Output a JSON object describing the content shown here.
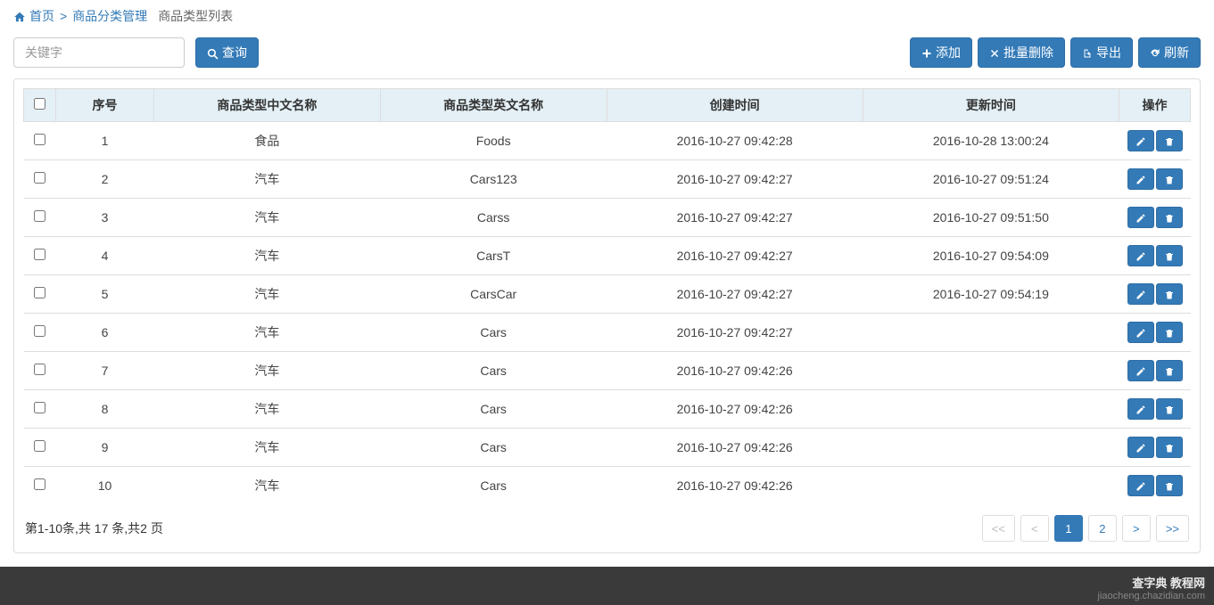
{
  "breadcrumb": {
    "home": "首页",
    "section": "商品分类管理",
    "current": "商品类型列表"
  },
  "search": {
    "placeholder": "关键字",
    "btn": "查询"
  },
  "actions": {
    "add": "添加",
    "batch_delete": "批量删除",
    "export": "导出",
    "refresh": "刷新"
  },
  "table": {
    "headers": {
      "index": "序号",
      "cn_name": "商品类型中文名称",
      "en_name": "商品类型英文名称",
      "created": "创建时间",
      "updated": "更新时间",
      "ops": "操作"
    },
    "rows": [
      {
        "idx": "1",
        "cn": "食品",
        "en": "Foods",
        "created": "2016-10-27 09:42:28",
        "updated": "2016-10-28 13:00:24"
      },
      {
        "idx": "2",
        "cn": "汽车",
        "en": "Cars123",
        "created": "2016-10-27 09:42:27",
        "updated": "2016-10-27 09:51:24"
      },
      {
        "idx": "3",
        "cn": "汽车",
        "en": "Carss",
        "created": "2016-10-27 09:42:27",
        "updated": "2016-10-27 09:51:50"
      },
      {
        "idx": "4",
        "cn": "汽车",
        "en": "CarsT",
        "created": "2016-10-27 09:42:27",
        "updated": "2016-10-27 09:54:09"
      },
      {
        "idx": "5",
        "cn": "汽车",
        "en": "CarsCar",
        "created": "2016-10-27 09:42:27",
        "updated": "2016-10-27 09:54:19"
      },
      {
        "idx": "6",
        "cn": "汽车",
        "en": "Cars",
        "created": "2016-10-27 09:42:27",
        "updated": ""
      },
      {
        "idx": "7",
        "cn": "汽车",
        "en": "Cars",
        "created": "2016-10-27 09:42:26",
        "updated": ""
      },
      {
        "idx": "8",
        "cn": "汽车",
        "en": "Cars",
        "created": "2016-10-27 09:42:26",
        "updated": ""
      },
      {
        "idx": "9",
        "cn": "汽车",
        "en": "Cars",
        "created": "2016-10-27 09:42:26",
        "updated": ""
      },
      {
        "idx": "10",
        "cn": "汽车",
        "en": "Cars",
        "created": "2016-10-27 09:42:26",
        "updated": ""
      }
    ]
  },
  "pager": {
    "summary": "第1-10条,共 17 条,共2 页",
    "first": "<<",
    "prev": "<",
    "p1": "1",
    "p2": "2",
    "next": ">",
    "last": ">>"
  },
  "watermark": {
    "top": "查字典 教程网",
    "sub": "jiaocheng.chazidian.com"
  }
}
